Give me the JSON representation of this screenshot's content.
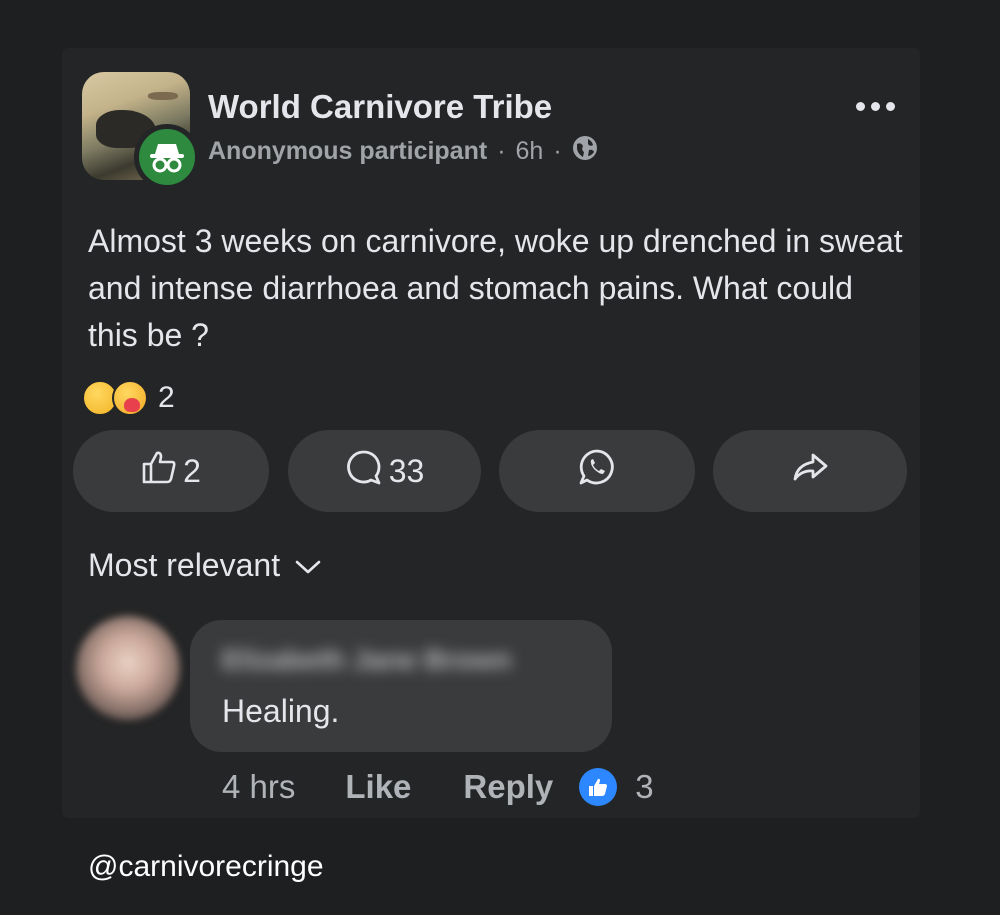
{
  "post": {
    "group_name": "World Carnivore Tribe",
    "author": "Anonymous participant",
    "separator": "·",
    "time": "6h",
    "privacy_icon": "globe-icon",
    "text": "Almost 3 weeks on carnivore, woke up drenched in sweat and intense diarrhoea and stomach pains. What could this be ?",
    "reactions": {
      "icons": [
        "sad-reaction-icon",
        "care-reaction-icon"
      ],
      "count": "2"
    }
  },
  "actions": {
    "like_count": "2",
    "comment_count": "33",
    "whatsapp_icon": "whatsapp-icon",
    "share_icon": "share-icon"
  },
  "comments_header": {
    "sort_label": "Most relevant"
  },
  "comment": {
    "author": "Elizabeth Jane Brown",
    "text": "Healing.",
    "time": "4 hrs",
    "like_label": "Like",
    "reply_label": "Reply",
    "like_count": "3"
  },
  "watermark": "@carnivorecringe"
}
